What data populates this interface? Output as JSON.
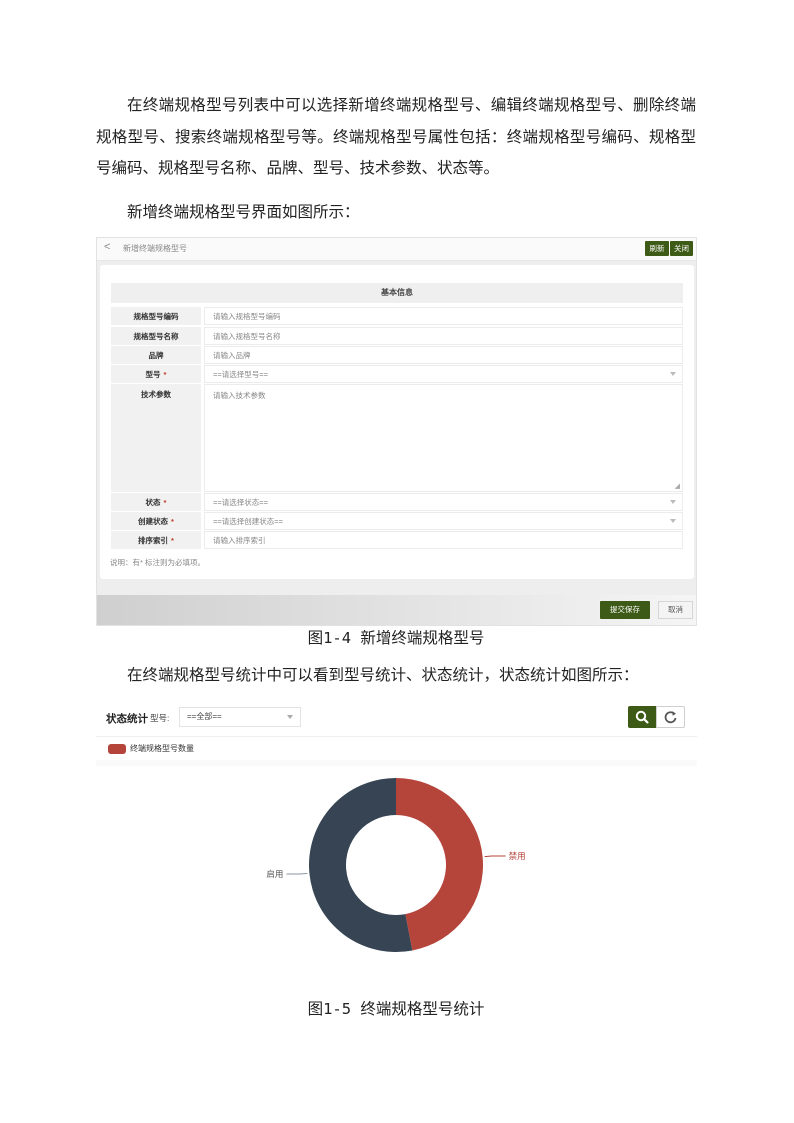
{
  "para1": "在终端规格型号列表中可以选择新增终端规格型号、编辑终端规格型号、删除终端规格型号、搜索终端规格型号等。终端规格型号属性包括：终端规格型号编码、规格型号编码、规格型号名称、品牌、型号、技术参数、状态等。",
  "para2": "新增终端规格型号界面如图所示：",
  "fig1": {
    "caption": "图1-4 新增终端规格型号",
    "back_glyph": "<",
    "page_title": "新增终端规格型号",
    "refresh_label": "刷新",
    "close_label": "关闭",
    "section_title": "基本信息",
    "fields": [
      {
        "label": "规格型号编码",
        "required": false,
        "value": "请输入规格型号编码"
      },
      {
        "label": "规格型号名称",
        "required": false,
        "value": "请输入规格型号名称"
      },
      {
        "label": "品牌",
        "required": false,
        "value": "请输入品牌"
      },
      {
        "label": "型号",
        "required": true,
        "value": "==请选择型号=="
      },
      {
        "label": "技术参数",
        "required": false,
        "value": "请输入技术参数"
      },
      {
        "label": "状态",
        "required": true,
        "value": "==请选择状态=="
      },
      {
        "label": "创建状态",
        "required": true,
        "value": "==请选择创建状态=="
      },
      {
        "label": "排序索引",
        "required": true,
        "value": "请输入排序索引"
      }
    ],
    "required_mark": "*",
    "note": "说明：有* 标注则为必填项。",
    "submit_label": "提交保存",
    "cancel_label": "取消"
  },
  "para3": "在终端规格型号统计中可以看到型号统计、状态统计，状态统计如图所示：",
  "fig2": {
    "caption": "图1-5 终端规格型号统计",
    "title": "状态统计",
    "filter_label": "型号:",
    "filter_value": "==全部==",
    "search_icon": "search-icon",
    "refresh_icon": "refresh-icon"
  },
  "chart_data": {
    "type": "pie",
    "donut": true,
    "legend": [
      "终端规格型号数量"
    ],
    "legend_position": "top-left",
    "slices": [
      {
        "label": "禁用",
        "value": 47,
        "color": "#b5443a"
      },
      {
        "label": "启用",
        "value": 53,
        "color": "#364453"
      }
    ]
  },
  "colors": {
    "accent": "#3d5a17",
    "required": "#c0392b"
  }
}
